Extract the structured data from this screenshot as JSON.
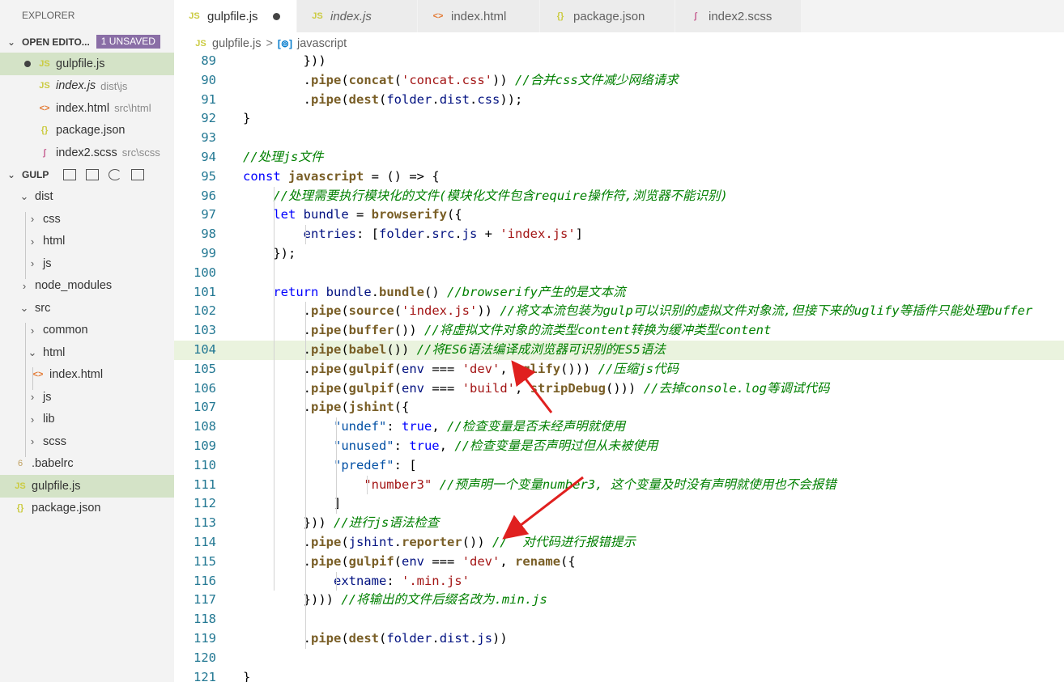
{
  "explorer": {
    "title": "EXPLORER",
    "open_editors": {
      "label": "OPEN EDITO...",
      "badge": "1 UNSAVED",
      "files": [
        {
          "icon": "JS",
          "name": "gulpfile.js",
          "desc": ""
        },
        {
          "icon": "JS",
          "name": "index.js",
          "desc": "dist\\js"
        },
        {
          "icon": "<>",
          "name": "index.html",
          "desc": "src\\html"
        },
        {
          "icon": "{}",
          "name": "package.json",
          "desc": ""
        },
        {
          "icon": "ʃ",
          "name": "index2.scss",
          "desc": "src\\scss"
        }
      ]
    },
    "project": {
      "label": "GULP",
      "tree": [
        {
          "chevron": "v",
          "name": "dist"
        },
        {
          "chevron": ">",
          "name": "css"
        },
        {
          "chevron": ">",
          "name": "html"
        },
        {
          "chevron": ">",
          "name": "js"
        },
        {
          "chevron": ">",
          "name": "node_modules"
        },
        {
          "chevron": "v",
          "name": "src"
        },
        {
          "chevron": ">",
          "name": "common"
        },
        {
          "chevron": "v",
          "name": "html"
        },
        {
          "icon": "<>",
          "name": "index.html"
        },
        {
          "chevron": ">",
          "name": "js"
        },
        {
          "chevron": ">",
          "name": "lib"
        },
        {
          "chevron": ">",
          "name": "scss"
        },
        {
          "icon": "6",
          "name": ".babelrc"
        },
        {
          "icon": "JS",
          "name": "gulpfile.js"
        },
        {
          "icon": "{}",
          "name": "package.json"
        }
      ]
    }
  },
  "tabs": [
    {
      "icon": "JS",
      "label": "gulpfile.js"
    },
    {
      "icon": "JS",
      "label": "index.js"
    },
    {
      "icon": "<>",
      "label": "index.html"
    },
    {
      "icon": "{}",
      "label": "package.json"
    },
    {
      "icon": "ʃ",
      "label": "index2.scss"
    }
  ],
  "breadcrumb": {
    "file_icon": "JS",
    "file": "gulpfile.js",
    "separator": ">",
    "symbol_icon": "[⊚]",
    "symbol": "javascript"
  },
  "editor": {
    "partial_top": "}))",
    "lines": [
      {
        "n": "89",
        "text": "        }))"
      },
      {
        "n": "90",
        "text": "        .pipe(concat('concat.css')) //合并css文件减少网络请求"
      },
      {
        "n": "91",
        "text": "        .pipe(dest(folder.dist.css));"
      },
      {
        "n": "92",
        "text": "}"
      },
      {
        "n": "93",
        "text": ""
      },
      {
        "n": "94",
        "text": "//处理js文件"
      },
      {
        "n": "95",
        "text": "const javascript = () => {"
      },
      {
        "n": "96",
        "text": "    //处理需要执行模块化的文件(模块化文件包含require操作符,浏览器不能识别)"
      },
      {
        "n": "97",
        "text": "    let bundle = browserify({"
      },
      {
        "n": "98",
        "text": "        entries: [folder.src.js + 'index.js']"
      },
      {
        "n": "99",
        "text": "    });"
      },
      {
        "n": "100",
        "text": ""
      },
      {
        "n": "101",
        "text": "    return bundle.bundle() //browserify产生的是文本流"
      },
      {
        "n": "102",
        "text": "        .pipe(source('index.js')) //将文本流包装为gulp可以识别的虚拟文件对象流,但接下来的uglify等插件只能处理buffer"
      },
      {
        "n": "103",
        "text": "        .pipe(buffer()) //将虚拟文件对象的流类型content转换为缓冲类型content"
      },
      {
        "n": "104",
        "text": "        .pipe(babel()) //将ES6语法编译成浏览器可识别的ES5语法"
      },
      {
        "n": "105",
        "text": "        .pipe(gulpif(env === 'dev', uglify())) //压缩js代码"
      },
      {
        "n": "106",
        "text": "        .pipe(gulpif(env === 'build', stripDebug())) //去掉console.log等调试代码"
      },
      {
        "n": "107",
        "text": "        .pipe(jshint({"
      },
      {
        "n": "108",
        "text": "            \"undef\": true, //检查变量是否未经声明就使用"
      },
      {
        "n": "109",
        "text": "            \"unused\": true, //检查变量是否声明过但从未被使用"
      },
      {
        "n": "110",
        "text": "            \"predef\": ["
      },
      {
        "n": "111",
        "text": "                \"number3\" //预声明一个变量number3, 这个变量及时没有声明就使用也不会报错"
      },
      {
        "n": "112",
        "text": "            ]"
      },
      {
        "n": "113",
        "text": "        })) //进行js语法检查"
      },
      {
        "n": "114",
        "text": "        .pipe(jshint.reporter()) //  对代码进行报错提示"
      },
      {
        "n": "115",
        "text": "        .pipe(gulpif(env === 'dev', rename({"
      },
      {
        "n": "116",
        "text": "            extname: '.min.js'"
      },
      {
        "n": "117",
        "text": "        }))) //将输出的文件后缀名改为.min.js"
      },
      {
        "n": "118",
        "text": ""
      },
      {
        "n": "119",
        "text": "        .pipe(dest(folder.dist.js))"
      },
      {
        "n": "120",
        "text": ""
      },
      {
        "n": "121",
        "text": "}"
      }
    ]
  },
  "colors": {
    "highlight_line": "#eaf3de",
    "annotation_arrow": "#e0201f",
    "badge": "#8a6ea6"
  }
}
